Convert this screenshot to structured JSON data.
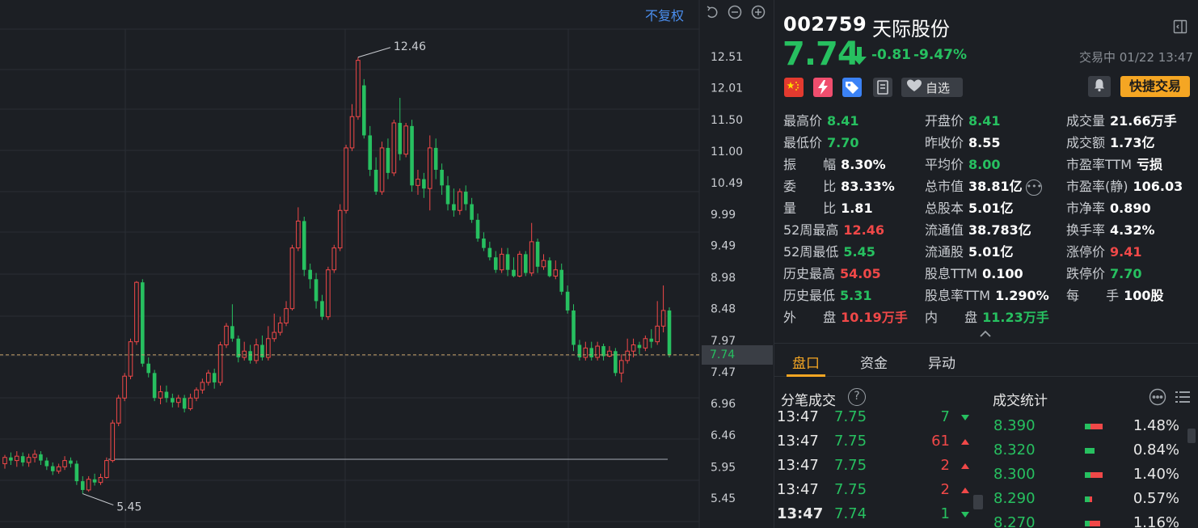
{
  "chart": {
    "fq_label": "不复权",
    "current_price_label": "7.74",
    "price_axis": [
      "12.51",
      "12.01",
      "11.50",
      "11.00",
      "10.49",
      "9.99",
      "9.49",
      "8.98",
      "8.48",
      "7.97",
      "7.47",
      "6.96",
      "6.46",
      "5.95",
      "5.45"
    ],
    "high_label": "12.46",
    "low_label": "5.45"
  },
  "chart_data": {
    "type": "candlestick",
    "y_range": [
      5.2,
      12.8
    ],
    "current_price": 7.74,
    "support_line": 6.05,
    "max_marker": 12.46,
    "min_marker": 5.45,
    "candles": [
      [
        6.0,
        6.1,
        5.92,
        6.14
      ],
      [
        6.1,
        6.05,
        5.98,
        6.18
      ],
      [
        6.05,
        6.12,
        5.95,
        6.2
      ],
      [
        6.12,
        6.02,
        5.96,
        6.18
      ],
      [
        6.02,
        6.1,
        5.95,
        6.16
      ],
      [
        6.1,
        6.15,
        6.02,
        6.22
      ],
      [
        6.15,
        6.05,
        5.98,
        6.2
      ],
      [
        6.05,
        5.96,
        5.9,
        6.1
      ],
      [
        5.96,
        5.88,
        5.82,
        6.02
      ],
      [
        5.88,
        5.95,
        5.84,
        6.0
      ],
      [
        5.95,
        6.05,
        5.9,
        6.12
      ],
      [
        6.05,
        6.0,
        5.94,
        6.1
      ],
      [
        6.0,
        5.72,
        5.66,
        6.05
      ],
      [
        5.72,
        5.58,
        5.52,
        5.8
      ],
      [
        5.58,
        5.75,
        5.55,
        5.8
      ],
      [
        5.75,
        5.7,
        5.65,
        5.84
      ],
      [
        5.7,
        5.78,
        5.66,
        5.84
      ],
      [
        5.78,
        6.05,
        5.76,
        6.1
      ],
      [
        6.05,
        6.65,
        6.02,
        6.7
      ],
      [
        6.65,
        7.05,
        6.6,
        7.1
      ],
      [
        7.05,
        7.4,
        7.0,
        7.45
      ],
      [
        7.4,
        7.95,
        7.35,
        8.0
      ],
      [
        7.95,
        8.9,
        7.9,
        8.92
      ],
      [
        8.9,
        7.6,
        7.55,
        8.95
      ],
      [
        7.6,
        7.45,
        7.38,
        7.7
      ],
      [
        7.45,
        7.05,
        7.0,
        7.5
      ],
      [
        7.05,
        7.15,
        6.95,
        7.25
      ],
      [
        7.15,
        7.05,
        6.98,
        7.25
      ],
      [
        7.05,
        6.98,
        6.9,
        7.12
      ],
      [
        6.98,
        7.05,
        6.9,
        7.1
      ],
      [
        7.05,
        6.88,
        6.82,
        7.1
      ],
      [
        6.88,
        7.05,
        6.85,
        7.12
      ],
      [
        7.05,
        7.18,
        7.0,
        7.22
      ],
      [
        7.18,
        7.3,
        7.12,
        7.36
      ],
      [
        7.3,
        7.45,
        7.25,
        7.5
      ],
      [
        7.45,
        7.3,
        7.2,
        7.52
      ],
      [
        7.3,
        7.9,
        7.25,
        7.95
      ],
      [
        7.9,
        8.2,
        7.85,
        8.25
      ],
      [
        8.2,
        8.0,
        7.95,
        8.55
      ],
      [
        8.0,
        7.7,
        7.62,
        8.05
      ],
      [
        7.7,
        7.8,
        7.65,
        7.95
      ],
      [
        7.8,
        7.65,
        7.6,
        7.9
      ],
      [
        7.65,
        7.9,
        7.6,
        8.0
      ],
      [
        7.9,
        7.7,
        7.65,
        8.05
      ],
      [
        7.7,
        8.0,
        7.65,
        8.2
      ],
      [
        8.0,
        8.1,
        7.95,
        8.4
      ],
      [
        8.1,
        8.25,
        8.05,
        8.35
      ],
      [
        8.25,
        8.48,
        8.2,
        8.6
      ],
      [
        8.48,
        9.45,
        8.45,
        9.5
      ],
      [
        9.45,
        9.88,
        9.4,
        10.1
      ],
      [
        9.88,
        9.1,
        9.0,
        9.95
      ],
      [
        9.1,
        8.95,
        8.8,
        9.2
      ],
      [
        8.95,
        8.6,
        8.48,
        9.05
      ],
      [
        8.6,
        8.35,
        8.3,
        8.7
      ],
      [
        8.35,
        9.1,
        8.3,
        9.15
      ],
      [
        9.1,
        9.45,
        9.05,
        9.5
      ],
      [
        9.45,
        10.05,
        9.4,
        10.15
      ],
      [
        10.05,
        11.05,
        10.0,
        11.1
      ],
      [
        11.05,
        11.55,
        11.0,
        11.75
      ],
      [
        11.55,
        12.45,
        11.5,
        12.5
      ],
      [
        12.05,
        11.25,
        11.2,
        12.15
      ],
      [
        11.25,
        10.7,
        10.6,
        11.4
      ],
      [
        10.7,
        10.35,
        10.3,
        10.9
      ],
      [
        10.35,
        11.05,
        10.3,
        11.15
      ],
      [
        11.05,
        10.65,
        10.55,
        11.2
      ],
      [
        10.65,
        11.45,
        10.6,
        11.5
      ],
      [
        11.45,
        10.95,
        10.85,
        11.85
      ],
      [
        10.95,
        11.4,
        10.9,
        11.45
      ],
      [
        11.4,
        10.45,
        10.35,
        11.5
      ],
      [
        10.45,
        10.55,
        10.3,
        10.7
      ],
      [
        10.55,
        10.4,
        10.25,
        10.65
      ],
      [
        10.4,
        11.05,
        10.05,
        11.25
      ],
      [
        11.05,
        10.7,
        10.55,
        11.2
      ],
      [
        10.7,
        10.45,
        10.3,
        10.8
      ],
      [
        10.45,
        10.15,
        10.05,
        10.6
      ],
      [
        10.15,
        10.05,
        9.95,
        10.4
      ],
      [
        10.05,
        10.35,
        9.98,
        10.4
      ],
      [
        10.35,
        10.15,
        10.05,
        10.45
      ],
      [
        10.15,
        9.9,
        9.85,
        10.25
      ],
      [
        9.9,
        9.6,
        9.55,
        10.0
      ],
      [
        9.6,
        9.45,
        9.4,
        9.7
      ],
      [
        9.45,
        9.3,
        9.25,
        9.55
      ],
      [
        9.3,
        9.1,
        9.05,
        9.4
      ],
      [
        9.1,
        9.35,
        9.05,
        9.45
      ],
      [
        9.35,
        9.1,
        9.0,
        9.45
      ],
      [
        9.1,
        9.0,
        8.98,
        9.3
      ],
      [
        9.0,
        9.35,
        8.98,
        9.4
      ],
      [
        9.35,
        9.05,
        9.0,
        9.4
      ],
      [
        9.05,
        9.55,
        9.0,
        9.85
      ],
      [
        9.55,
        9.15,
        9.05,
        9.6
      ],
      [
        9.15,
        9.25,
        9.1,
        9.35
      ],
      [
        9.25,
        9.0,
        8.98,
        9.3
      ],
      [
        9.0,
        9.1,
        8.95,
        9.25
      ],
      [
        9.1,
        8.75,
        8.7,
        9.2
      ],
      [
        8.75,
        8.45,
        8.4,
        8.85
      ],
      [
        8.45,
        7.9,
        7.8,
        8.55
      ],
      [
        7.9,
        7.7,
        7.65,
        7.98
      ],
      [
        7.7,
        7.85,
        7.65,
        7.95
      ],
      [
        7.85,
        7.7,
        7.65,
        7.95
      ],
      [
        7.7,
        7.88,
        7.65,
        7.95
      ],
      [
        7.88,
        7.72,
        7.65,
        7.92
      ],
      [
        7.72,
        7.8,
        7.7,
        7.88
      ],
      [
        7.8,
        7.45,
        7.4,
        7.85
      ],
      [
        7.45,
        7.65,
        7.3,
        7.75
      ],
      [
        7.65,
        7.8,
        7.6,
        8.0
      ],
      [
        7.8,
        7.9,
        7.7,
        8.0
      ],
      [
        7.9,
        7.85,
        7.75,
        7.95
      ],
      [
        7.85,
        8.0,
        7.8,
        8.05
      ],
      [
        8.0,
        7.95,
        7.85,
        8.15
      ],
      [
        7.95,
        8.2,
        7.9,
        8.6
      ],
      [
        8.2,
        8.45,
        8.1,
        8.85
      ],
      [
        8.45,
        7.74,
        7.7,
        8.5
      ]
    ]
  },
  "header": {
    "code": "002759",
    "name": "天际股份",
    "price": "7.74",
    "change": "-0.81",
    "change_pct": "-9.47%",
    "status": "交易中 01/22 13:47"
  },
  "actions": {
    "watch_label": "自选",
    "quick_trade_label": "快捷交易"
  },
  "quotes": {
    "col1": [
      {
        "label": "最高价",
        "value": "8.41",
        "tone": "down"
      },
      {
        "label": "最低价",
        "value": "7.70",
        "tone": "down"
      },
      {
        "label": "振 幅",
        "value": "8.30%",
        "tone": "white",
        "spaced": true
      },
      {
        "label": "委 比",
        "value": "83.33%",
        "tone": "white",
        "spaced": true
      },
      {
        "label": "量 比",
        "value": "1.81",
        "tone": "white",
        "spaced": true
      },
      {
        "label": "52周最高",
        "value": "12.46",
        "tone": "up"
      },
      {
        "label": "52周最低",
        "value": "5.45",
        "tone": "down"
      },
      {
        "label": "历史最高",
        "value": "54.05",
        "tone": "up"
      },
      {
        "label": "历史最低",
        "value": "5.31",
        "tone": "down"
      },
      {
        "label": "外 盘",
        "value": "10.19万手",
        "tone": "up",
        "spaced": true
      }
    ],
    "col2": [
      {
        "label": "开盘价",
        "value": "8.41",
        "tone": "down"
      },
      {
        "label": "昨收价",
        "value": "8.55",
        "tone": "white"
      },
      {
        "label": "平均价",
        "value": "8.00",
        "tone": "down"
      },
      {
        "label": "总市值",
        "value": "38.81亿",
        "tone": "white",
        "more": true
      },
      {
        "label": "总股本",
        "value": "5.01亿",
        "tone": "white"
      },
      {
        "label": "流通值",
        "value": "38.783亿",
        "tone": "white"
      },
      {
        "label": "流通股",
        "value": "5.01亿",
        "tone": "white"
      },
      {
        "label": "股息TTM",
        "value": "0.100",
        "tone": "white"
      },
      {
        "label": "股息率TTM",
        "value": "1.290%",
        "tone": "white"
      },
      {
        "label": "内 盘",
        "value": "11.23万手",
        "tone": "down",
        "spaced": true
      }
    ],
    "col3": [
      {
        "label": "成交量",
        "value": "21.66万手",
        "tone": "white"
      },
      {
        "label": "成交额",
        "value": "1.73亿",
        "tone": "white"
      },
      {
        "label": "市盈率TTM",
        "value": "亏损",
        "tone": "white"
      },
      {
        "label": "市盈率(静)",
        "value": "106.03",
        "tone": "white"
      },
      {
        "label": "市净率",
        "value": "0.890",
        "tone": "white"
      },
      {
        "label": "换手率",
        "value": "4.32%",
        "tone": "white"
      },
      {
        "label": "涨停价",
        "value": "9.41",
        "tone": "up"
      },
      {
        "label": "跌停价",
        "value": "7.70",
        "tone": "down"
      },
      {
        "label": "每 手",
        "value": "100股",
        "tone": "white",
        "spaced": true
      }
    ]
  },
  "tabs": [
    "盘口",
    "资金",
    "异动"
  ],
  "ticks_title": "分笔成交",
  "stats_title": "成交统计",
  "ticks": [
    {
      "time": "13:47",
      "price": "7.75",
      "vol": "7",
      "dir": "down",
      "bold": false
    },
    {
      "time": "13:47",
      "price": "7.75",
      "vol": "61",
      "dir": "up",
      "bold": false
    },
    {
      "time": "13:47",
      "price": "7.75",
      "vol": "2",
      "dir": "up",
      "bold": false
    },
    {
      "time": "13:47",
      "price": "7.75",
      "vol": "2",
      "dir": "up",
      "bold": false
    },
    {
      "time": "13:47",
      "price": "7.74",
      "vol": "1",
      "dir": "down",
      "bold": true
    }
  ],
  "stats": [
    {
      "price": "8.390",
      "pct": "1.48%",
      "red": 0.7,
      "green": 0.3
    },
    {
      "price": "8.320",
      "pct": "0.84%",
      "red": 0.0,
      "green": 0.55
    },
    {
      "price": "8.300",
      "pct": "1.40%",
      "red": 0.7,
      "green": 0.3
    },
    {
      "price": "8.290",
      "pct": "0.57%",
      "red": 0.15,
      "green": 0.25
    },
    {
      "price": "8.270",
      "pct": "1.16%",
      "red": 0.6,
      "green": 0.25
    }
  ],
  "colors": {
    "up": "#f04848",
    "down": "#27c060",
    "accent": "#f5a623",
    "bg": "#1c1f24"
  }
}
